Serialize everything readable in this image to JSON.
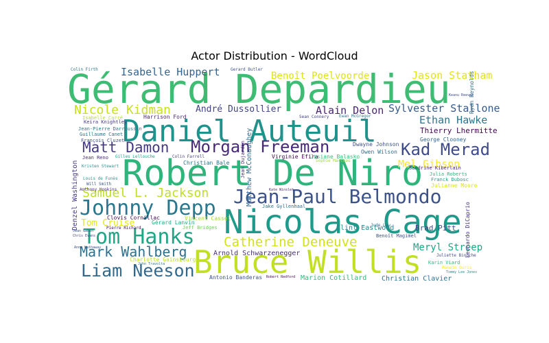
{
  "chart_data": {
    "type": "wordcloud",
    "title": "Actor Distribution - WordCloud",
    "words": [
      {
        "text": "Gérard Depardieu",
        "weight": 100,
        "color": "#3fbc73"
      },
      {
        "text": "Robert De Niro",
        "weight": 82,
        "color": "#2fb47c"
      },
      {
        "text": "Daniel Auteuil",
        "weight": 76,
        "color": "#20928c"
      },
      {
        "text": "Nicolas Cage",
        "weight": 74,
        "color": "#1f9a8a"
      },
      {
        "text": "Bruce Willis",
        "weight": 73,
        "color": "#c2df23"
      },
      {
        "text": "Jean-Paul Belmondo",
        "weight": 56,
        "color": "#3b528b"
      },
      {
        "text": "Johnny Depp",
        "weight": 50,
        "color": "#2a788e"
      },
      {
        "text": "Tom Hanks",
        "weight": 49,
        "color": "#21a585"
      },
      {
        "text": "Morgan Freeman",
        "weight": 40,
        "color": "#482878"
      },
      {
        "text": "Liam Neeson",
        "weight": 40,
        "color": "#31688e"
      },
      {
        "text": "Kad Merad",
        "weight": 38,
        "color": "#3e4a89"
      },
      {
        "text": "Matt Damon",
        "weight": 34,
        "color": "#443983"
      },
      {
        "text": "Mark Wahlberg",
        "weight": 34,
        "color": "#2c728e"
      },
      {
        "text": "Catherine Deneuve",
        "weight": 33,
        "color": "#d2e21b"
      },
      {
        "text": "Samuel L. Jackson",
        "weight": 31,
        "color": "#bddf26"
      },
      {
        "text": "Nicole Kidman",
        "weight": 29,
        "color": "#c8e020"
      },
      {
        "text": "Isabelle Huppert",
        "weight": 27,
        "color": "#33638d"
      },
      {
        "text": "Alain Delon",
        "weight": 26,
        "color": "#482475"
      },
      {
        "text": "Sylvester Stallone",
        "weight": 25,
        "color": "#375a8c"
      },
      {
        "text": "Jason Statham",
        "weight": 25,
        "color": "#e2e418"
      },
      {
        "text": "Benoît Poelvoorde",
        "weight": 23,
        "color": "#dde318"
      },
      {
        "text": "Ethan Hawke",
        "weight": 24,
        "color": "#2a768e"
      },
      {
        "text": "Mel Gibson",
        "weight": 24,
        "color": "#fde725"
      },
      {
        "text": "Meryl Streep",
        "weight": 23,
        "color": "#21a685"
      },
      {
        "text": "Tom Cruise",
        "weight": 20,
        "color": "#e5e419"
      },
      {
        "text": "André Dussollier",
        "weight": 20,
        "color": "#414487"
      },
      {
        "text": "Thierry Lhermitte",
        "weight": 18,
        "color": "#440154"
      },
      {
        "text": "Clint Eastwood",
        "weight": 16,
        "color": "#25848e"
      },
      {
        "text": "Brad Pitt",
        "weight": 16,
        "color": "#3e4c8a"
      },
      {
        "text": "Christian Clavier",
        "weight": 16,
        "color": "#2d708e"
      },
      {
        "text": "Marion Cotillard",
        "weight": 16,
        "color": "#35b779"
      },
      {
        "text": "Arnold Schwarzenegger",
        "weight": 17,
        "color": "#472d7b"
      },
      {
        "text": "Denzel Washington",
        "weight": 15,
        "color": "#443a83"
      },
      {
        "text": "Matthew McConaughey",
        "weight": 13,
        "color": "#31688e"
      },
      {
        "text": "Antonio Banderas",
        "weight": 13,
        "color": "#3b528b"
      },
      {
        "text": "Virginie Efira",
        "weight": 14,
        "color": "#440154"
      },
      {
        "text": "George Clooney",
        "weight": 14,
        "color": "#32648e"
      },
      {
        "text": "Dwayne Johnson",
        "weight": 13,
        "color": "#3b518b"
      },
      {
        "text": "Owen Wilson",
        "weight": 13,
        "color": "#2e6f8e"
      },
      {
        "text": "Josiane Balasko",
        "weight": 13,
        "color": "#3cbb75"
      },
      {
        "text": "Christian Bale",
        "weight": 13,
        "color": "#2b758e"
      },
      {
        "text": "Harrison Ford",
        "weight": 13,
        "color": "#481f70"
      },
      {
        "text": "Clovis Cornillac",
        "weight": 13,
        "color": "#46085c"
      },
      {
        "text": "Vincent Cassel",
        "weight": 13,
        "color": "#a2da37"
      },
      {
        "text": "Gérard Lanvin",
        "weight": 13,
        "color": "#22a884"
      },
      {
        "text": "Jeff Bridges",
        "weight": 12,
        "color": "#6ece58"
      },
      {
        "text": "Keira Knightley",
        "weight": 12,
        "color": "#443983"
      },
      {
        "text": "Jean-Pierre Darroussin",
        "weight": 11,
        "color": "#2a788e"
      },
      {
        "text": "Guillaume Canet",
        "weight": 11,
        "color": "#2c728e"
      },
      {
        "text": "François Cluzet",
        "weight": 11,
        "color": "#3b528b"
      },
      {
        "text": "Isabelle Carré",
        "weight": 11,
        "color": "#b5de2b"
      },
      {
        "text": "Julia Roberts",
        "weight": 11,
        "color": "#2db27d"
      },
      {
        "text": "Franck Dubosc",
        "weight": 11,
        "color": "#1fa188"
      },
      {
        "text": "Julianne Moore",
        "weight": 12,
        "color": "#d8e219"
      },
      {
        "text": "Sandrine Kiberlain",
        "weight": 11,
        "color": "#482173"
      },
      {
        "text": "Benoît Magimel",
        "weight": 11,
        "color": "#3b528b"
      },
      {
        "text": "Juliette Binoche",
        "weight": 11,
        "color": "#3e4989"
      },
      {
        "text": "Karin Viard",
        "weight": 11,
        "color": "#2fb47c"
      },
      {
        "text": "Romain Duris",
        "weight": 10,
        "color": "#fde725"
      },
      {
        "text": "Tommy Lee Jones",
        "weight": 10,
        "color": "#1f968b"
      },
      {
        "text": "Jude Law",
        "weight": 10,
        "color": "#2c728e"
      },
      {
        "text": "Jean Reno",
        "weight": 11,
        "color": "#482878"
      },
      {
        "text": "Kristen Stewart",
        "weight": 10,
        "color": "#21918c"
      },
      {
        "text": "Louis de Funès",
        "weight": 10,
        "color": "#1e9b8a"
      },
      {
        "text": "Will Smith",
        "weight": 10,
        "color": "#39568c"
      },
      {
        "text": "Anthony Hopkins",
        "weight": 9,
        "color": "#472c7a"
      },
      {
        "text": "Leonardo DiCaprio",
        "weight": 11,
        "color": "#46337e"
      },
      {
        "text": "Ryan Reynolds",
        "weight": 11,
        "color": "#2e6e8e"
      },
      {
        "text": "Jake Gyllenhaal",
        "weight": 11,
        "color": "#2d708e"
      },
      {
        "text": "Keanu Reeves",
        "weight": 10,
        "color": "#3e4a89"
      },
      {
        "text": "Colin Firth",
        "weight": 9,
        "color": "#2c728e"
      },
      {
        "text": "Colin Farrell",
        "weight": 9,
        "color": "#433e85"
      },
      {
        "text": "Gerard Butler",
        "weight": 9,
        "color": "#3b528b"
      },
      {
        "text": "Kate Winslet",
        "weight": 9,
        "color": "#482677"
      },
      {
        "text": "Sean Connery",
        "weight": 9,
        "color": "#424086"
      },
      {
        "text": "Ewan McGregor",
        "weight": 9,
        "color": "#2a788e"
      },
      {
        "text": "Gilles Lellouche",
        "weight": 9,
        "color": "#1fa088"
      },
      {
        "text": "Pierre Richard",
        "weight": 9,
        "color": "#440154"
      },
      {
        "text": "Jean Dujardin",
        "weight": 9,
        "color": "#46307e"
      },
      {
        "text": "Charlotte Gainsbourg",
        "weight": 9,
        "color": "#b8de29"
      },
      {
        "text": "Anne Hathaway",
        "weight": 8,
        "color": "#3d4e8a"
      },
      {
        "text": "Sophie Marceau",
        "weight": 8,
        "color": "#9dd93b"
      },
      {
        "text": "Chris Evans",
        "weight": 7,
        "color": "#414487"
      },
      {
        "text": "Jean Gabin",
        "weight": 7,
        "color": "#39558c"
      },
      {
        "text": "John Travolta",
        "weight": 8,
        "color": "#2a768e"
      },
      {
        "text": "Robert Redford",
        "weight": 8,
        "color": "#440154"
      },
      {
        "text": "Christian Bale",
        "weight": 0,
        "color": "#000000"
      }
    ]
  }
}
